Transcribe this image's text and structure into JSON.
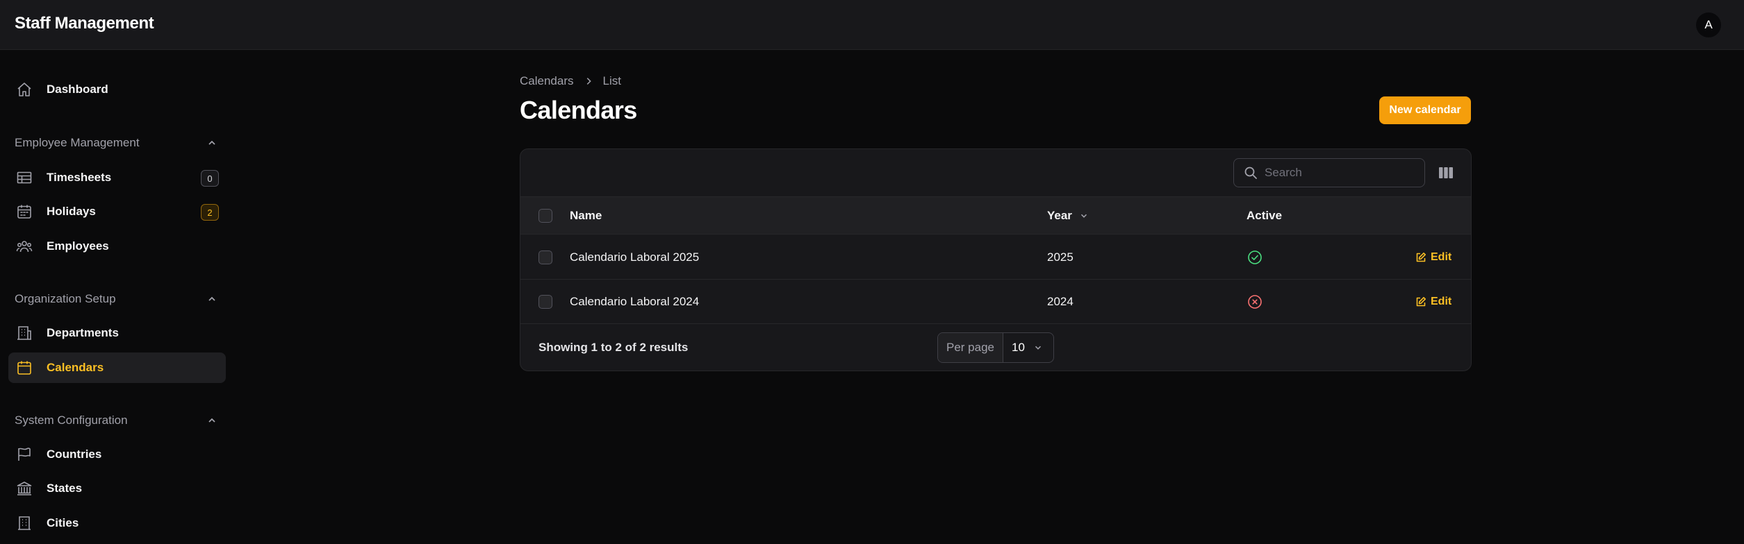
{
  "app": {
    "title": "Staff Management",
    "avatar_initial": "A"
  },
  "sidebar": {
    "dashboard": {
      "label": "Dashboard",
      "icon": "home-icon"
    },
    "groups": [
      {
        "label": "Employee Management",
        "items": [
          {
            "label": "Timesheets",
            "icon": "table-icon",
            "badge": "0"
          },
          {
            "label": "Holidays",
            "icon": "calendar-days-icon",
            "badge": "2"
          },
          {
            "label": "Employees",
            "icon": "users-icon"
          }
        ]
      },
      {
        "label": "Organization Setup",
        "items": [
          {
            "label": "Departments",
            "icon": "building-office-icon"
          },
          {
            "label": "Calendars",
            "icon": "calendar-icon",
            "active": true
          }
        ]
      },
      {
        "label": "System Configuration",
        "items": [
          {
            "label": "Countries",
            "icon": "flag-icon"
          },
          {
            "label": "States",
            "icon": "building-library-icon"
          },
          {
            "label": "Cities",
            "icon": "building-icon"
          }
        ]
      }
    ]
  },
  "breadcrumb": {
    "parent": "Calendars",
    "current": "List"
  },
  "page": {
    "title": "Calendars",
    "new_button": "New calendar"
  },
  "table": {
    "search_placeholder": "Search",
    "columns": {
      "name": "Name",
      "year": "Year",
      "active": "Active"
    },
    "rows": [
      {
        "name": "Calendario Laboral 2025",
        "year": "2025",
        "active": true,
        "action": "Edit"
      },
      {
        "name": "Calendario Laboral 2024",
        "year": "2024",
        "active": false,
        "action": "Edit"
      }
    ],
    "showing": "Showing 1 to 2 of 2 results",
    "per_page_label": "Per page",
    "per_page_value": "10"
  },
  "colors": {
    "accent": "#f59e0b",
    "active_nav": "#fbbf24",
    "success": "#4ade80",
    "danger": "#f87171"
  }
}
